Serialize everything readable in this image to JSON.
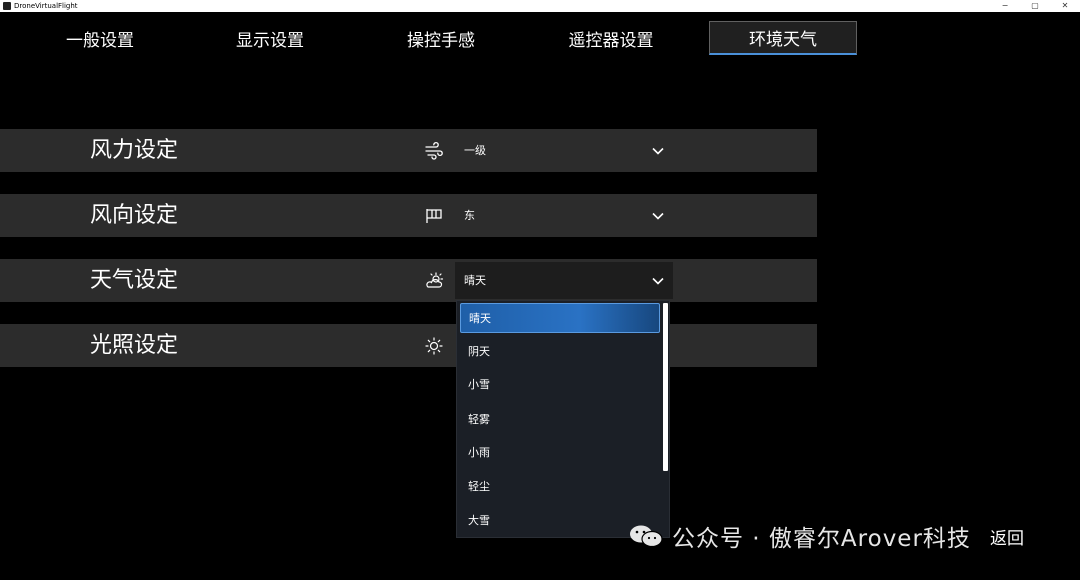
{
  "window": {
    "title": "DroneVirtualFlight",
    "controls": [
      "−",
      "▢",
      "✕"
    ]
  },
  "tabs": [
    {
      "label": "一般设置"
    },
    {
      "label": "显示设置"
    },
    {
      "label": "操控手感"
    },
    {
      "label": "遥控器设置"
    },
    {
      "label": "环境天气",
      "active": true
    }
  ],
  "settings": [
    {
      "label": "风力设定",
      "icon": "wind-icon",
      "value": "一级"
    },
    {
      "label": "风向设定",
      "icon": "flag-icon",
      "value": "东"
    },
    {
      "label": "天气设定",
      "icon": "weather-icon",
      "value": "晴天",
      "open": true
    },
    {
      "label": "光照设定",
      "icon": "sun-icon",
      "value": ""
    }
  ],
  "weather_options": [
    "晴天",
    "阴天",
    "小雪",
    "轻雾",
    "小雨",
    "轻尘",
    "大雪"
  ],
  "weather_selected": "晴天",
  "watermark": {
    "text": "公众号 · 傲睿尔Arover科技"
  },
  "back_label": "返回",
  "colors": {
    "accent": "#2a72c4",
    "row_bg": "#2c2c2c",
    "dropdown_bg": "#1b1f26"
  }
}
